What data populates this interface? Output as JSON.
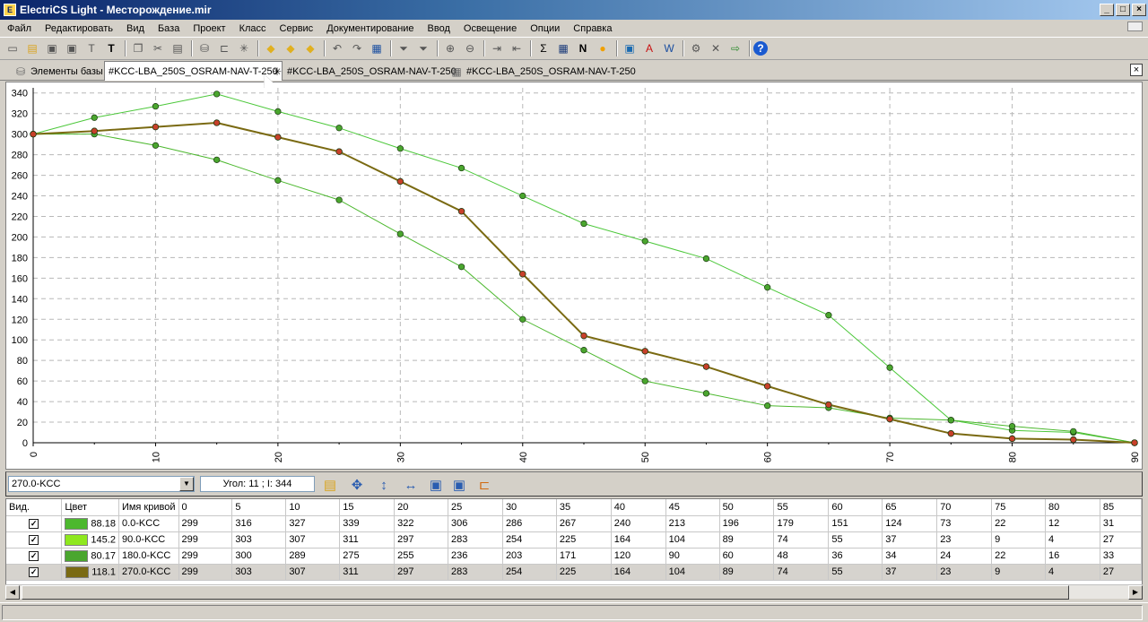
{
  "window": {
    "title": "ElectriCS Light - Месторождение.mir"
  },
  "menu": [
    "Файл",
    "Редактировать",
    "Вид",
    "База",
    "Проект",
    "Класс",
    "Сервис",
    "Документирование",
    "Ввод",
    "Освещение",
    "Опции",
    "Справка"
  ],
  "tabs": [
    {
      "label": "Элементы базы",
      "icon": "database-icon"
    },
    {
      "label": "#KCC-LBA_250S_OSRAM-NAV-T-250",
      "icon": "none",
      "active": true
    },
    {
      "label": "#KCC-LBA_250S_OSRAM-NAV-T-250",
      "icon": "polar-star-icon"
    },
    {
      "label": "#KCC-LBA_250S_OSRAM-NAV-T-250",
      "icon": "table-grid-icon"
    }
  ],
  "controls": {
    "curve_select": "270.0-KCC",
    "angle_readout": "Угол: 11 ; I: 344"
  },
  "chart_data": {
    "type": "line",
    "x": [
      0,
      5,
      10,
      15,
      20,
      25,
      30,
      35,
      40,
      45,
      50,
      55,
      60,
      65,
      70,
      75,
      80,
      85,
      90
    ],
    "x_ticks": [
      0,
      10,
      20,
      30,
      40,
      50,
      60,
      70,
      80,
      90
    ],
    "y_ticks": [
      0,
      20,
      40,
      60,
      80,
      100,
      120,
      140,
      160,
      180,
      200,
      220,
      240,
      260,
      280,
      300,
      320,
      340
    ],
    "xlim": [
      0,
      90
    ],
    "ylim": [
      0,
      345
    ],
    "grid": true,
    "series": [
      {
        "values": [
          300,
          316,
          327,
          339,
          322,
          306,
          286,
          267,
          240,
          213,
          196,
          179,
          151,
          124,
          73,
          22,
          12,
          10,
          0
        ],
        "color": "#4cc83a",
        "marker": "#4aa62e"
      },
      {
        "values": [
          300,
          303,
          307,
          311,
          297,
          283,
          254,
          225,
          164,
          104,
          89,
          74,
          55,
          37,
          23,
          9,
          4,
          3,
          0
        ],
        "color": "#8ee81e",
        "marker": "#7a5c12"
      },
      {
        "values": [
          300,
          300,
          289,
          275,
          255,
          236,
          203,
          171,
          120,
          90,
          60,
          48,
          36,
          34,
          24,
          22,
          16,
          11,
          0
        ],
        "color": "#4cb82e",
        "marker": "#4aa62e"
      },
      {
        "values": [
          300,
          303,
          307,
          311,
          297,
          283,
          254,
          225,
          164,
          104,
          89,
          74,
          55,
          37,
          23,
          9,
          4,
          3,
          0
        ],
        "color": "#7a6a12",
        "marker": "#c8402a"
      }
    ]
  },
  "table": {
    "headers": [
      "Вид.",
      "Цвет",
      "Имя кривой",
      "0",
      "5",
      "10",
      "15",
      "20",
      "25",
      "30",
      "35",
      "40",
      "45",
      "50",
      "55",
      "60",
      "65",
      "70",
      "75",
      "80",
      "85"
    ],
    "rows": [
      {
        "checked": "✓",
        "color": "#4cb82e",
        "value": "88.18",
        "name": "0.0-KCC",
        "cells": [
          "299",
          "316",
          "327",
          "339",
          "322",
          "306",
          "286",
          "267",
          "240",
          "213",
          "196",
          "179",
          "151",
          "124",
          "73",
          "22",
          "12",
          "31"
        ]
      },
      {
        "checked": "✓",
        "color": "#8ee81e",
        "value": "145.2",
        "name": "90.0-KCC",
        "cells": [
          "299",
          "303",
          "307",
          "311",
          "297",
          "283",
          "254",
          "225",
          "164",
          "104",
          "89",
          "74",
          "55",
          "37",
          "23",
          "9",
          "4",
          "27"
        ]
      },
      {
        "checked": "✓",
        "color": "#4aa62e",
        "value": "80.17",
        "name": "180.0-KCC",
        "cells": [
          "299",
          "300",
          "289",
          "275",
          "255",
          "236",
          "203",
          "171",
          "120",
          "90",
          "60",
          "48",
          "36",
          "34",
          "24",
          "22",
          "16",
          "33"
        ]
      },
      {
        "checked": "✓",
        "color": "#7a6a12",
        "value": "118.1",
        "name": "270.0-KCC",
        "cells": [
          "299",
          "303",
          "307",
          "311",
          "297",
          "283",
          "254",
          "225",
          "164",
          "104",
          "89",
          "74",
          "55",
          "37",
          "23",
          "9",
          "4",
          "27"
        ],
        "selected": true
      }
    ]
  }
}
